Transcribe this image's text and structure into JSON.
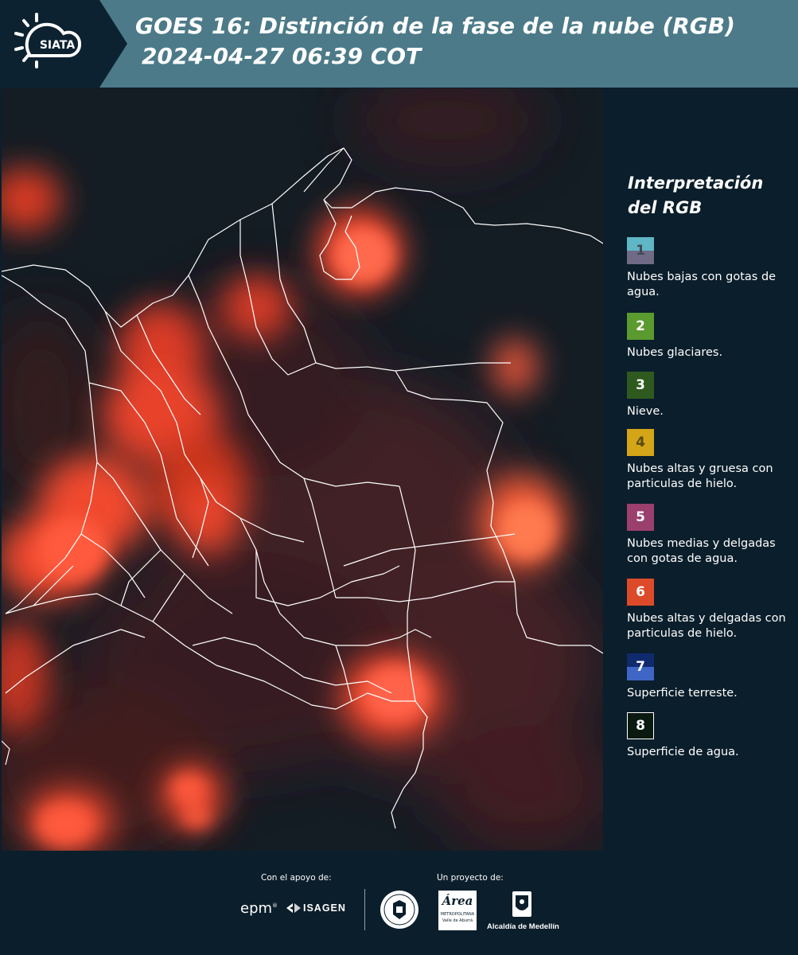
{
  "header": {
    "logo_text": "SIATA",
    "title_line1": "GOES 16: Distinción de la fase de la nube (RGB)",
    "title_line2": "2024-04-27 06:39 COT"
  },
  "legend": {
    "title_line1": "Interpretación",
    "title_line2": "del RGB",
    "items": [
      {
        "num": "1",
        "label": "Nubes bajas con gotas de agua.",
        "color_top": "#5fb6c4",
        "color_bottom": "#6f6a86",
        "num_color": "#3f4a55"
      },
      {
        "num": "2",
        "label": "Nubes glaciares.",
        "color_top": "#5a9a2e",
        "color_bottom": "#5a9a2e",
        "num_color": "#ffffff"
      },
      {
        "num": "3",
        "label": "Nieve.",
        "color_top": "#2e5a1f",
        "color_bottom": "#2e5a1f",
        "num_color": "#ffffff"
      },
      {
        "num": "4",
        "label": "Nubes altas y gruesa con particulas de hielo.",
        "color_top": "#d4a517",
        "color_bottom": "#d4a517",
        "num_color": "#5a4a10"
      },
      {
        "num": "5",
        "label": "Nubes medias y delgadas con gotas de agua.",
        "color_top": "#9a3f6e",
        "color_bottom": "#9a3f6e",
        "num_color": "#ffffff"
      },
      {
        "num": "6",
        "label": "Nubes altas y delgadas con particulas de hielo.",
        "color_top": "#dd4a2a",
        "color_bottom": "#dd4a2a",
        "num_color": "#ffffff"
      },
      {
        "num": "7",
        "label": "Superficie terreste.",
        "color_top": "#102a6e",
        "color_bottom": "#3f66c4",
        "num_color": "#ffffff"
      },
      {
        "num": "8",
        "label": "Superficie de agua.",
        "color_top": "#0a1a10",
        "color_bottom": "#0a1a10",
        "num_color": "#ffffff",
        "border": "#ffffff"
      }
    ]
  },
  "footer": {
    "support_label": "Con el apoyo de:",
    "project_label": "Un proyecto de:",
    "epm_text": "epm",
    "isagen_text": "ISAGEN",
    "area_text": "Área",
    "area_sub": "METROPOLITANA",
    "area_sub2": "Valle de Aburrá",
    "alcaldia_text": "Alcaldía de Medellín"
  }
}
